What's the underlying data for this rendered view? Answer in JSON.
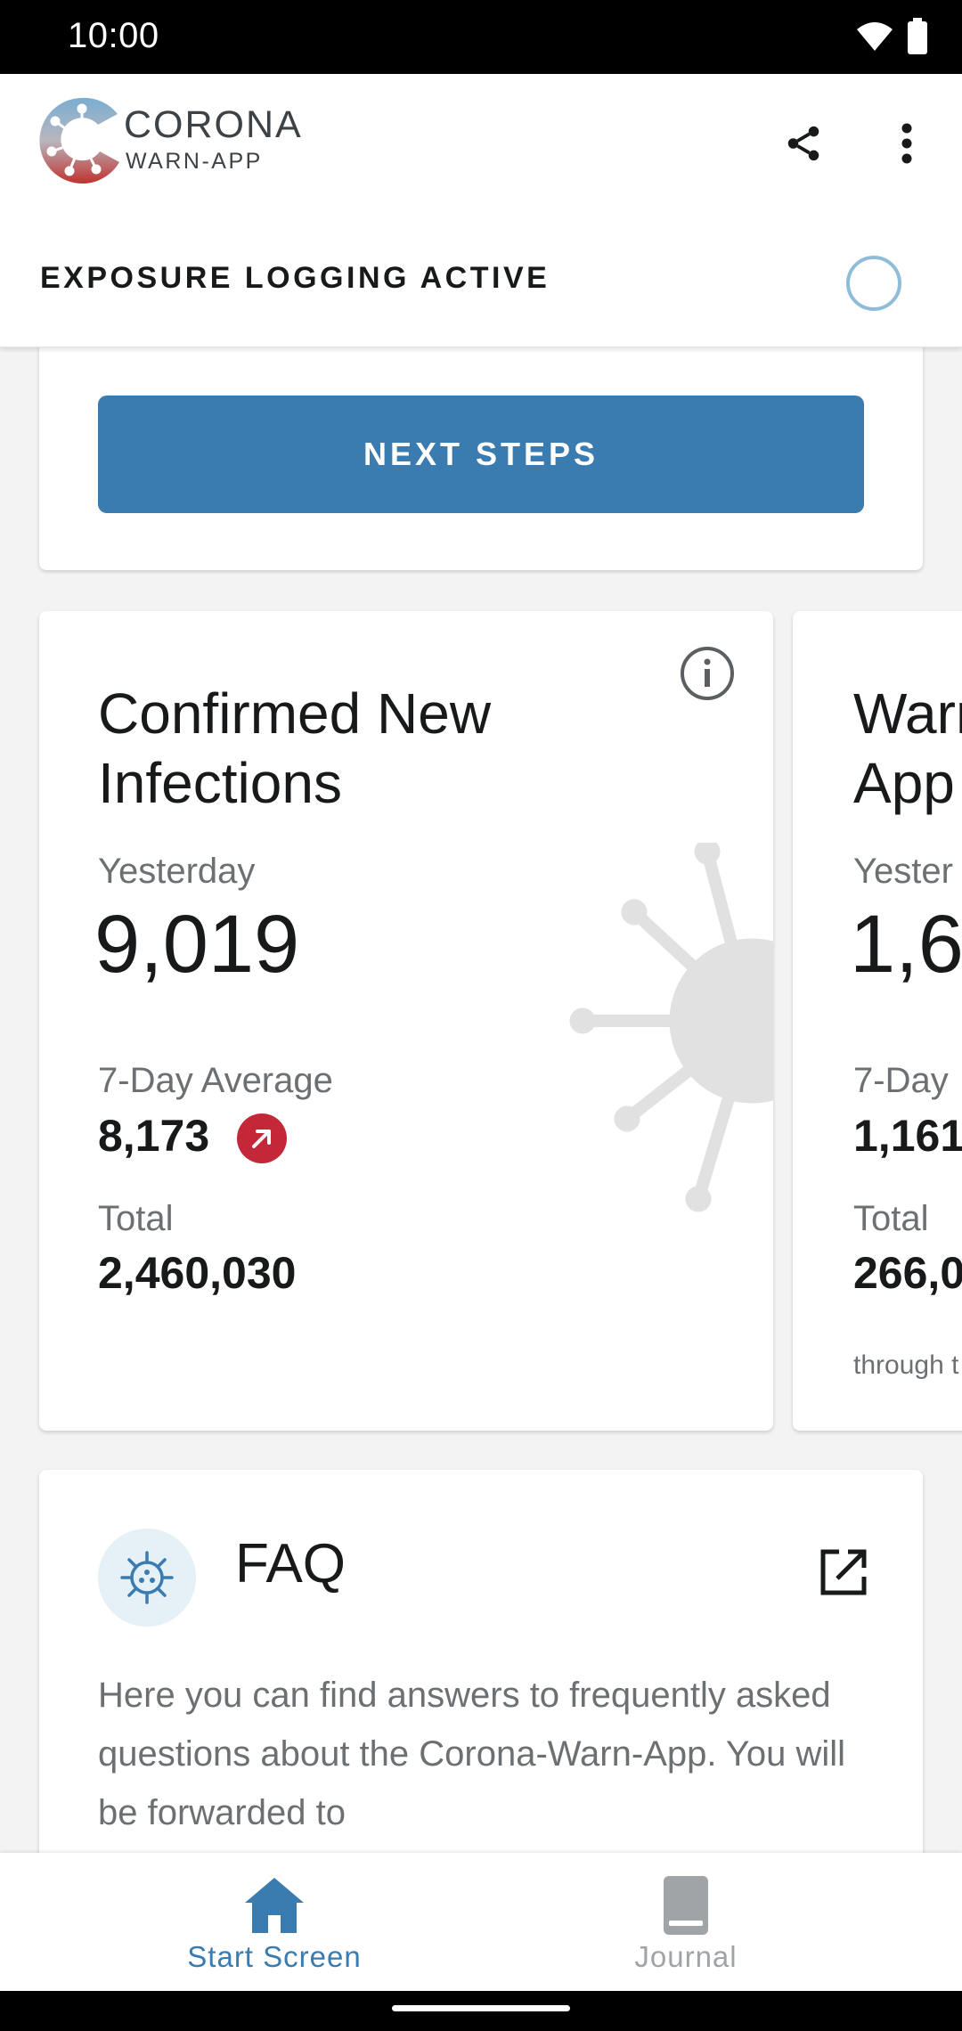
{
  "status_bar": {
    "time": "10:00"
  },
  "header": {
    "logo_title": "CORONA",
    "logo_subtitle": "WARN-APP",
    "exposure_status": "EXPOSURE LOGGING ACTIVE"
  },
  "next_steps": {
    "button_label": "NEXT STEPS"
  },
  "statistics": [
    {
      "title": "Confirmed New Infections",
      "yesterday_label": "Yesterday",
      "yesterday_value": "9,019",
      "avg_label": "7-Day Average",
      "avg_value": "8,173",
      "total_label": "Total",
      "total_value": "2,460,030",
      "trend": "up"
    },
    {
      "title_line1": "Warn",
      "title_line2": "App",
      "yesterday_label": "Yester",
      "yesterday_value": "1,6",
      "avg_label": "7-Day",
      "avg_value": "1,161",
      "total_label": "Total",
      "total_value": "266,0",
      "footnote": "through t"
    }
  ],
  "faq": {
    "title": "FAQ",
    "body": "Here you can find answers to frequently asked questions about the Corona-Warn-App. You will be forwarded to"
  },
  "bottom_nav": {
    "items": [
      {
        "label": "Start Screen",
        "active": true
      },
      {
        "label": "Journal",
        "active": false
      }
    ]
  },
  "colors": {
    "primary": "#3a7bb0",
    "trend_up": "#c32738",
    "inactive": "#a0a4a7"
  }
}
